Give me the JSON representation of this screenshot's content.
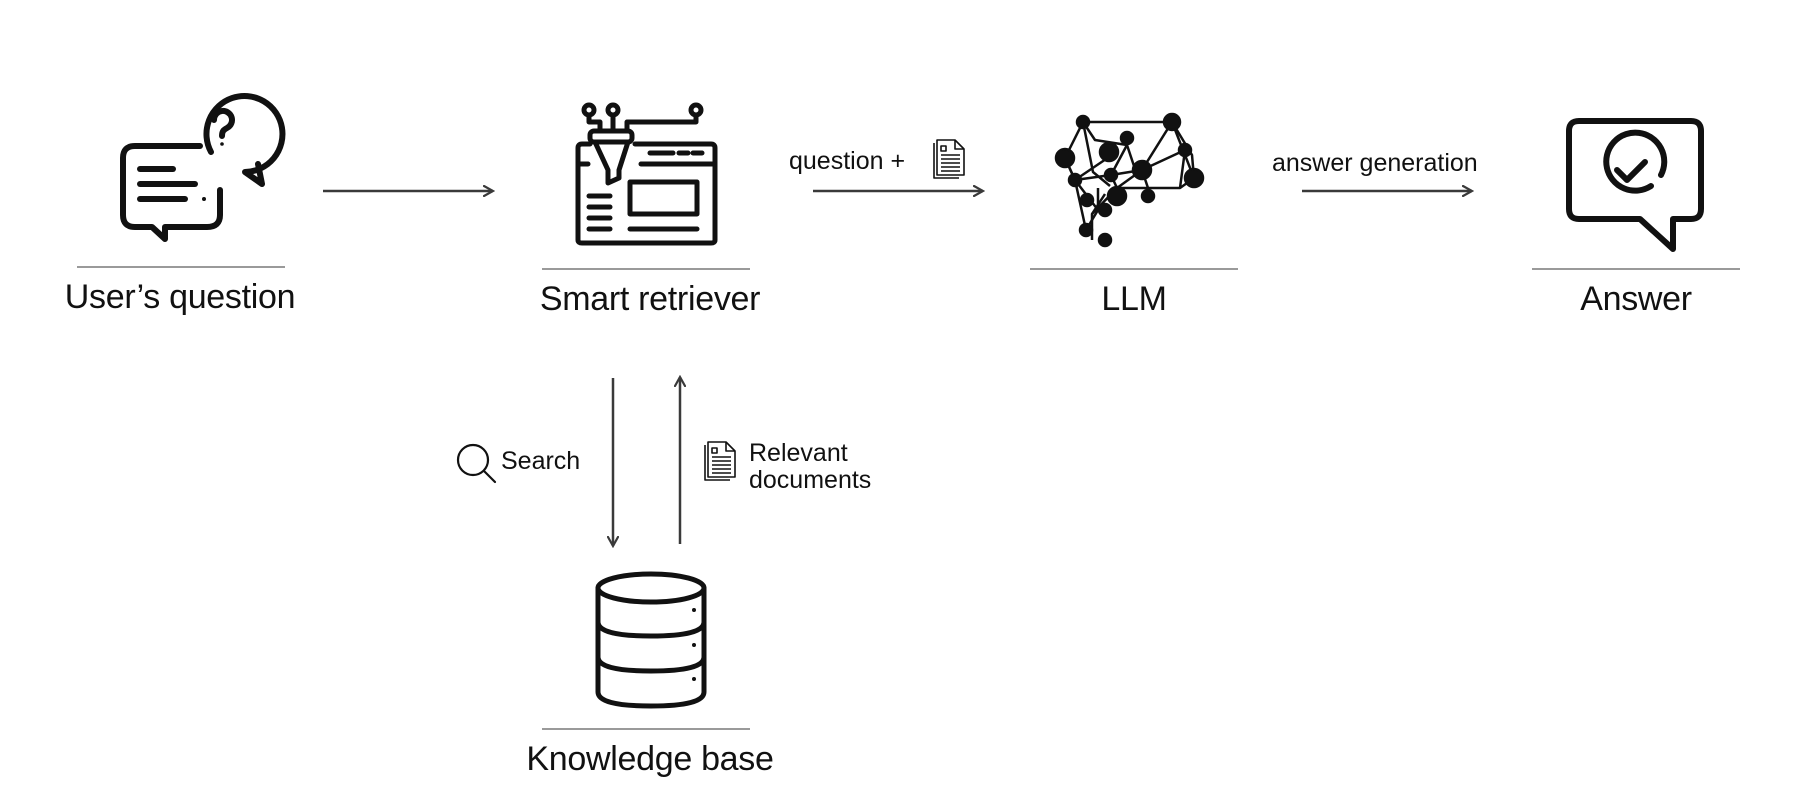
{
  "diagram": {
    "type": "flow",
    "nodes": [
      {
        "id": "users-question",
        "label": "User’s question",
        "icon": "chat-question-icon"
      },
      {
        "id": "smart-retriever",
        "label": "Smart retriever",
        "icon": "funnel-window-icon"
      },
      {
        "id": "llm",
        "label": "LLM",
        "icon": "brain-network-icon"
      },
      {
        "id": "answer",
        "label": "Answer",
        "icon": "chat-check-icon"
      },
      {
        "id": "knowledge-base",
        "label": "Knowledge base",
        "icon": "database-icon"
      }
    ],
    "edges": [
      {
        "from": "users-question",
        "to": "smart-retriever",
        "label": ""
      },
      {
        "from": "smart-retriever",
        "to": "llm",
        "label": "question +",
        "label_icon": "document-icon"
      },
      {
        "from": "llm",
        "to": "answer",
        "label": "answer generation"
      },
      {
        "from": "smart-retriever",
        "to": "knowledge-base",
        "label": "Search",
        "label_icon": "search-icon"
      },
      {
        "from": "knowledge-base",
        "to": "smart-retriever",
        "label": "Relevant documents",
        "label_lines": [
          "Relevant",
          "documents"
        ],
        "label_icon": "document-icon"
      }
    ]
  },
  "colors": {
    "icon": "#111111",
    "arrow": "#3a3a3a",
    "divider": "#9a9a9a",
    "background": "#ffffff"
  }
}
